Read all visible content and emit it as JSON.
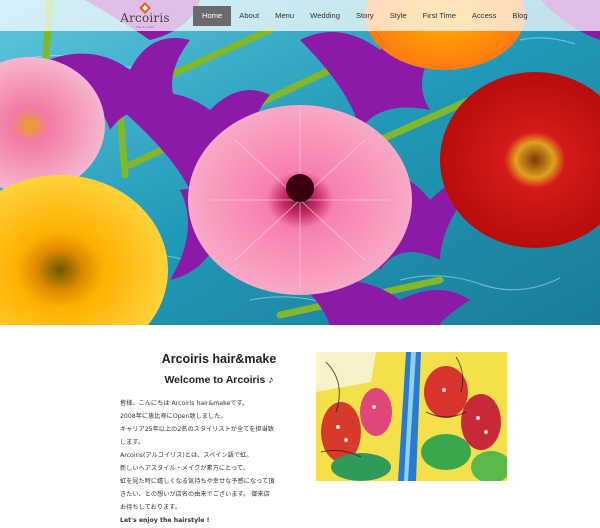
{
  "header": {
    "logo": {
      "name": "Arcoiris",
      "sub": "hair & make"
    },
    "nav": [
      {
        "label": "Home",
        "active": true
      },
      {
        "label": "About",
        "active": false
      },
      {
        "label": "Menu",
        "active": false
      },
      {
        "label": "Wedding",
        "active": false
      },
      {
        "label": "Story",
        "active": false
      },
      {
        "label": "Style",
        "active": false
      },
      {
        "label": "First Time",
        "active": false
      },
      {
        "label": "Access",
        "active": false
      },
      {
        "label": "Blog",
        "active": false
      }
    ]
  },
  "main": {
    "title": "Arcoiris hair&make",
    "welcome": "Welcome to Arcoiris ♪",
    "lines": [
      "皆様、こんにちは Arcoiris hair&makeです。",
      "2008年に恵比寿にOpen致しました。",
      "キャリア25年以上の2名のスタイリストが全てを担当致",
      "します。",
      "Arcoiris(アルコイリス)とは、スペイン語で虹。",
      "新しいヘアスタイル・メイクが素方にとって、",
      "虹を見た時に嬉しくなる気持ちや幸せな予感になって頂",
      "きたい、との想いが店名の由来でございます。 御来店",
      "お待ちしております。"
    ],
    "closing": "Let's enjoy the hairstyle !"
  },
  "colors": {
    "nav_active": "#6b6b6b",
    "water": "#2aa6c4",
    "text": "#333333"
  }
}
